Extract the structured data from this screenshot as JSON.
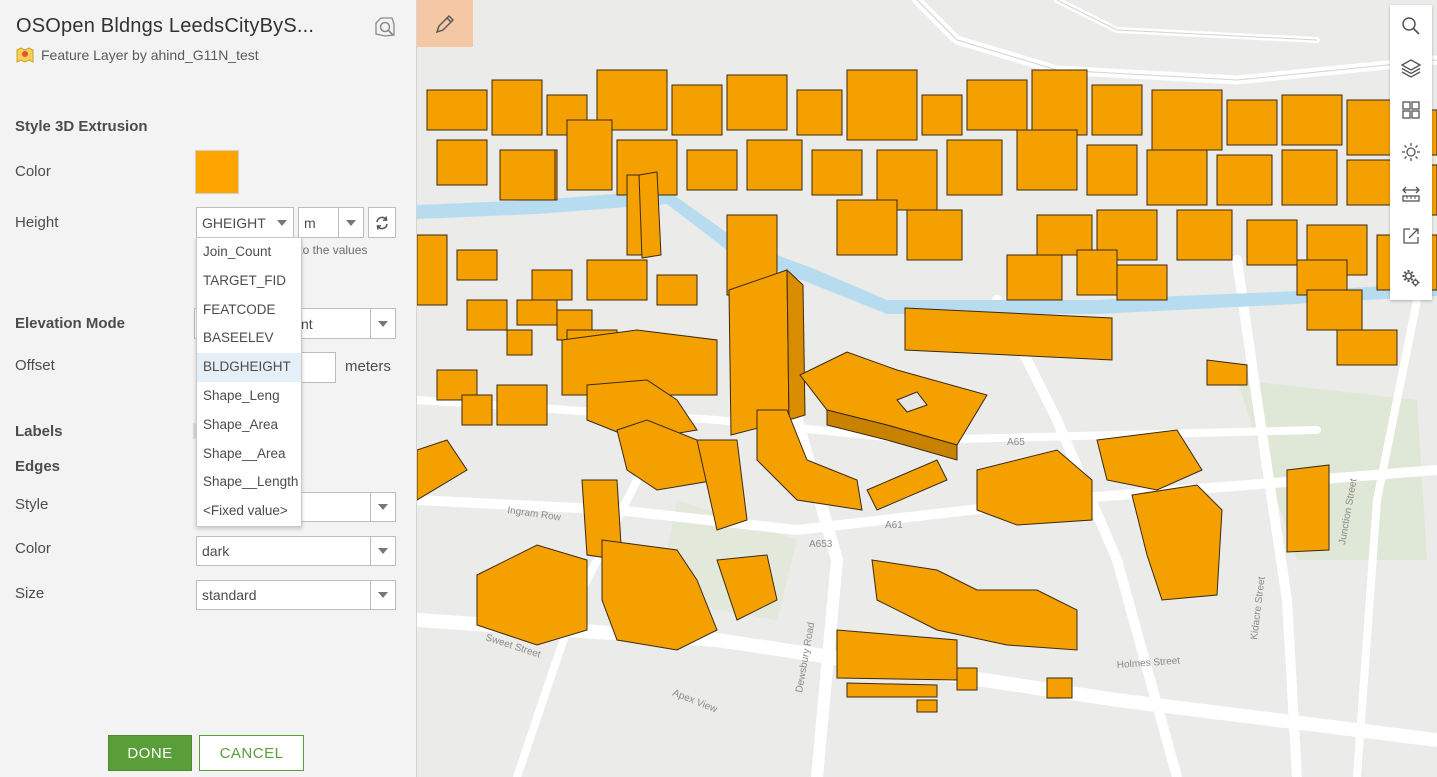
{
  "panel": {
    "title": "OSOpen Bldngs LeedsCityByS...",
    "subtitle": "Feature Layer by ahind_G11N_test",
    "style_section": "Style 3D Extrusion",
    "color_label": "Color",
    "color_value": "#ffa500",
    "height_label": "Height",
    "height_field_value": "GHEIGHT",
    "height_unit": "m",
    "hint_text": "et to the values",
    "elevation_label": "Elevation Mode",
    "elevation_value": "nt",
    "offset_label": "Offset",
    "offset_unit": "meters",
    "labels_label": "Labels",
    "edges_label": "Edges",
    "edge_style_label": "Style",
    "edge_color_label": "Color",
    "edge_color_value": "dark",
    "edge_size_label": "Size",
    "edge_size_value": "standard",
    "done_label": "DONE",
    "cancel_label": "CANCEL",
    "dropdown_options": [
      "Join_Count",
      "TARGET_FID",
      "FEATCODE",
      "BASEELEV",
      "BLDGHEIGHT",
      "Shape_Leng",
      "Shape_Area",
      "Shape__Area",
      "Shape__Length",
      "<Fixed value>"
    ],
    "dropdown_selected": "BLDGHEIGHT",
    "accent_color": "#5a9e3a"
  },
  "map": {
    "streets": [
      "Sweet Street",
      "Apex View",
      "Dewsbury Road",
      "Holmes Street",
      "Kidacre Street",
      "Junction Street",
      "Ingram Row",
      "A653",
      "A61",
      "A65"
    ],
    "toolbar_icons": [
      "search-icon",
      "layers-icon",
      "basemap-gallery-icon",
      "daylight-icon",
      "measure-icon",
      "share-icon",
      "settings-icon"
    ],
    "building_color": "#f3a000",
    "river_color": "#b7dcf0"
  }
}
